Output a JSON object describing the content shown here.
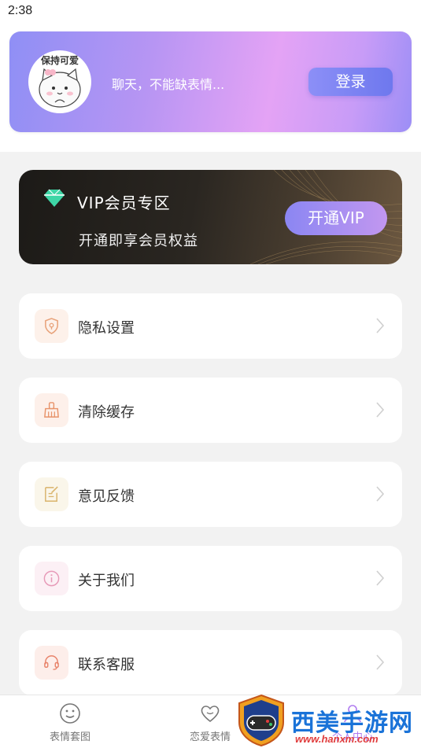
{
  "status_bar": {
    "time": "2:38"
  },
  "profile": {
    "avatar_text": "保持可爱",
    "greeting": "聊天，不能缺表情...",
    "login_label": "登录"
  },
  "vip": {
    "title": "VIP会员专区",
    "subtitle": "开通即享会员权益",
    "button_label": "开通VIP"
  },
  "menu": {
    "items": [
      {
        "label": "隐私设置",
        "icon": "shield-lock-icon",
        "icon_color": "#e8a27a",
        "icon_bg": "#fdf1ea"
      },
      {
        "label": "清除缓存",
        "icon": "broom-icon",
        "icon_color": "#e8936a",
        "icon_bg": "#fdf0ea"
      },
      {
        "label": "意见反馈",
        "icon": "edit-note-icon",
        "icon_color": "#d9b36a",
        "icon_bg": "#faf6ea"
      },
      {
        "label": "关于我们",
        "icon": "info-icon",
        "icon_color": "#e79ab8",
        "icon_bg": "#fcf0f5"
      },
      {
        "label": "联系客服",
        "icon": "headset-icon",
        "icon_color": "#e8836a",
        "icon_bg": "#fdeeea"
      }
    ]
  },
  "tabs": [
    {
      "label": "表情套图",
      "icon": "smile-icon"
    },
    {
      "label": "恋爱表情",
      "icon": "heart-icon"
    },
    {
      "label": "个人中心",
      "icon": "person-icon"
    }
  ],
  "watermark": {
    "text": "西美手游网",
    "url": "www.hanxm.com"
  },
  "colors": {
    "accent": "#8c8ff7",
    "vip_dark": "#1c1a17",
    "page_bg": "#f2f2f2"
  }
}
